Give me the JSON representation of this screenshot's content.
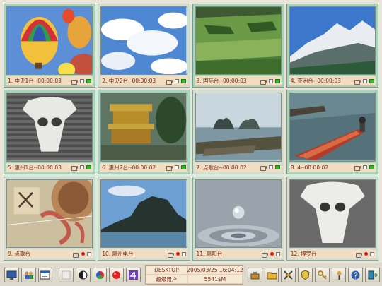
{
  "channels": [
    {
      "label": "1. 中央1台--00:00:03",
      "active": true
    },
    {
      "label": "2. 中央2台--00:00:03",
      "active": false
    },
    {
      "label": "3. 国际台--00:00:03",
      "active": true
    },
    {
      "label": "4. 亚洲台--00:00:03",
      "active": true
    },
    {
      "label": "5. 惠州1台--00:00:03",
      "active": true
    },
    {
      "label": "6. 惠州2台--00:00:02",
      "active": true
    },
    {
      "label": "7. 点歌台--00:00:02",
      "active": false
    },
    {
      "label": "8. 4--00:00:02",
      "active": true
    },
    {
      "label": "9. 点歌台",
      "active": false
    },
    {
      "label": "10. 惠州电台",
      "active": false
    },
    {
      "label": "11. 惠阳台",
      "active": false
    },
    {
      "label": "12. 博罗台",
      "active": false
    }
  ],
  "status_info": {
    "host": "DESKTOP",
    "datetime": "2005/03/25 16:04:12",
    "user": "超级用户",
    "free_space": "5541$M"
  },
  "toolbar": {
    "left_buttons": [
      "monitor-icon",
      "people-icon",
      "window-icon",
      "blank-icon",
      "contrast-icon",
      "color-wheel-icon",
      "red-ball-icon",
      "number-4-icon"
    ],
    "right_buttons": [
      "tools-icon",
      "folder-icon",
      "cross-tools-icon",
      "shield-icon",
      "key-icon",
      "record-icon",
      "help-icon",
      "exit-icon"
    ]
  }
}
